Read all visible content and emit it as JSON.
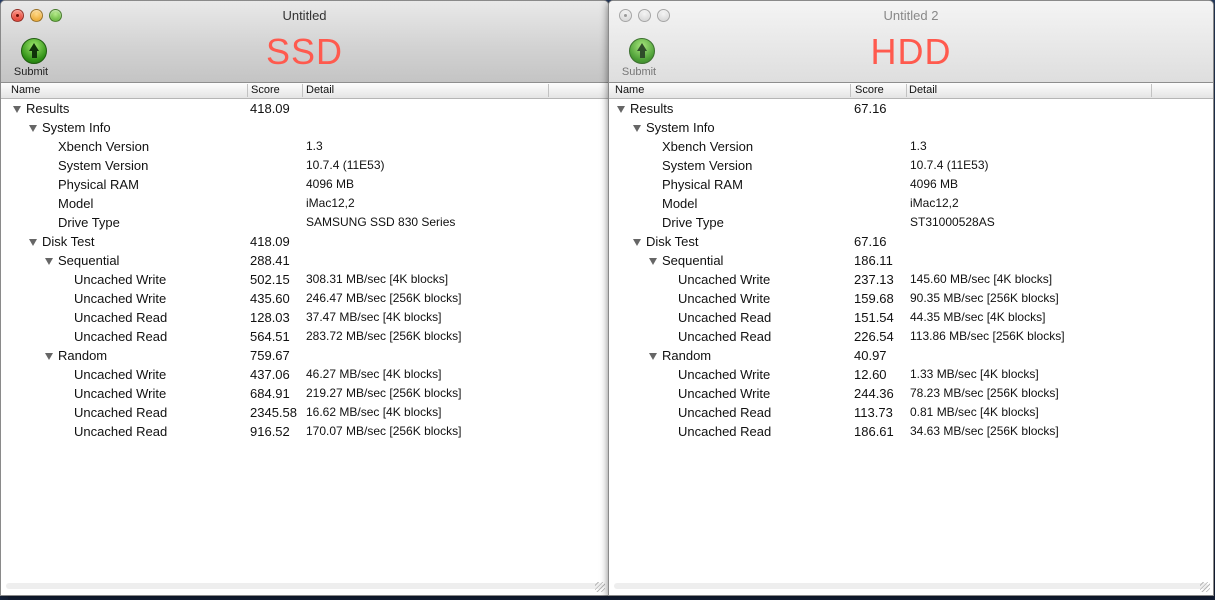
{
  "windows": [
    {
      "title": "Untitled",
      "label": "SSD",
      "submit_label": "Submit",
      "columns": {
        "name": "Name",
        "score": "Score",
        "detail": "Detail"
      },
      "rows": [
        {
          "name": "Results",
          "score": "418.09",
          "detail": ""
        },
        {
          "name": "System Info",
          "score": "",
          "detail": ""
        },
        {
          "name": "Xbench Version",
          "score": "",
          "detail": "1.3"
        },
        {
          "name": "System Version",
          "score": "",
          "detail": "10.7.4 (11E53)"
        },
        {
          "name": "Physical RAM",
          "score": "",
          "detail": "4096 MB"
        },
        {
          "name": "Model",
          "score": "",
          "detail": "iMac12,2"
        },
        {
          "name": "Drive Type",
          "score": "",
          "detail": "SAMSUNG SSD 830 Series"
        },
        {
          "name": "Disk Test",
          "score": "418.09",
          "detail": ""
        },
        {
          "name": "Sequential",
          "score": "288.41",
          "detail": ""
        },
        {
          "name": "Uncached Write",
          "score": "502.15",
          "detail": "308.31 MB/sec [4K blocks]"
        },
        {
          "name": "Uncached Write",
          "score": "435.60",
          "detail": "246.47 MB/sec [256K blocks]"
        },
        {
          "name": "Uncached Read",
          "score": "128.03",
          "detail": "37.47 MB/sec [4K blocks]"
        },
        {
          "name": "Uncached Read",
          "score": "564.51",
          "detail": "283.72 MB/sec [256K blocks]"
        },
        {
          "name": "Random",
          "score": "759.67",
          "detail": ""
        },
        {
          "name": "Uncached Write",
          "score": "437.06",
          "detail": "46.27 MB/sec [4K blocks]"
        },
        {
          "name": "Uncached Write",
          "score": "684.91",
          "detail": "219.27 MB/sec [256K blocks]"
        },
        {
          "name": "Uncached Read",
          "score": "2345.58",
          "detail": "16.62 MB/sec [4K blocks]"
        },
        {
          "name": "Uncached Read",
          "score": "916.52",
          "detail": "170.07 MB/sec [256K blocks]"
        }
      ]
    },
    {
      "title": "Untitled 2",
      "label": "HDD",
      "submit_label": "Submit",
      "columns": {
        "name": "Name",
        "score": "Score",
        "detail": "Detail"
      },
      "rows": [
        {
          "name": "Results",
          "score": "67.16",
          "detail": ""
        },
        {
          "name": "System Info",
          "score": "",
          "detail": ""
        },
        {
          "name": "Xbench Version",
          "score": "",
          "detail": "1.3"
        },
        {
          "name": "System Version",
          "score": "",
          "detail": "10.7.4 (11E53)"
        },
        {
          "name": "Physical RAM",
          "score": "",
          "detail": "4096 MB"
        },
        {
          "name": "Model",
          "score": "",
          "detail": "iMac12,2"
        },
        {
          "name": "Drive Type",
          "score": "",
          "detail": "ST31000528AS"
        },
        {
          "name": "Disk Test",
          "score": "67.16",
          "detail": ""
        },
        {
          "name": "Sequential",
          "score": "186.11",
          "detail": ""
        },
        {
          "name": "Uncached Write",
          "score": "237.13",
          "detail": "145.60 MB/sec [4K blocks]"
        },
        {
          "name": "Uncached Write",
          "score": "159.68",
          "detail": "90.35 MB/sec [256K blocks]"
        },
        {
          "name": "Uncached Read",
          "score": "151.54",
          "detail": "44.35 MB/sec [4K blocks]"
        },
        {
          "name": "Uncached Read",
          "score": "226.54",
          "detail": "113.86 MB/sec [256K blocks]"
        },
        {
          "name": "Random",
          "score": "40.97",
          "detail": ""
        },
        {
          "name": "Uncached Write",
          "score": "12.60",
          "detail": "1.33 MB/sec [4K blocks]"
        },
        {
          "name": "Uncached Write",
          "score": "244.36",
          "detail": "78.23 MB/sec [256K blocks]"
        },
        {
          "name": "Uncached Read",
          "score": "113.73",
          "detail": "0.81 MB/sec [4K blocks]"
        },
        {
          "name": "Uncached Read",
          "score": "186.61",
          "detail": "34.63 MB/sec [256K blocks]"
        }
      ]
    }
  ],
  "colors": {
    "label_red": "#ff5a4e",
    "submit_green": "#2e8f15"
  }
}
